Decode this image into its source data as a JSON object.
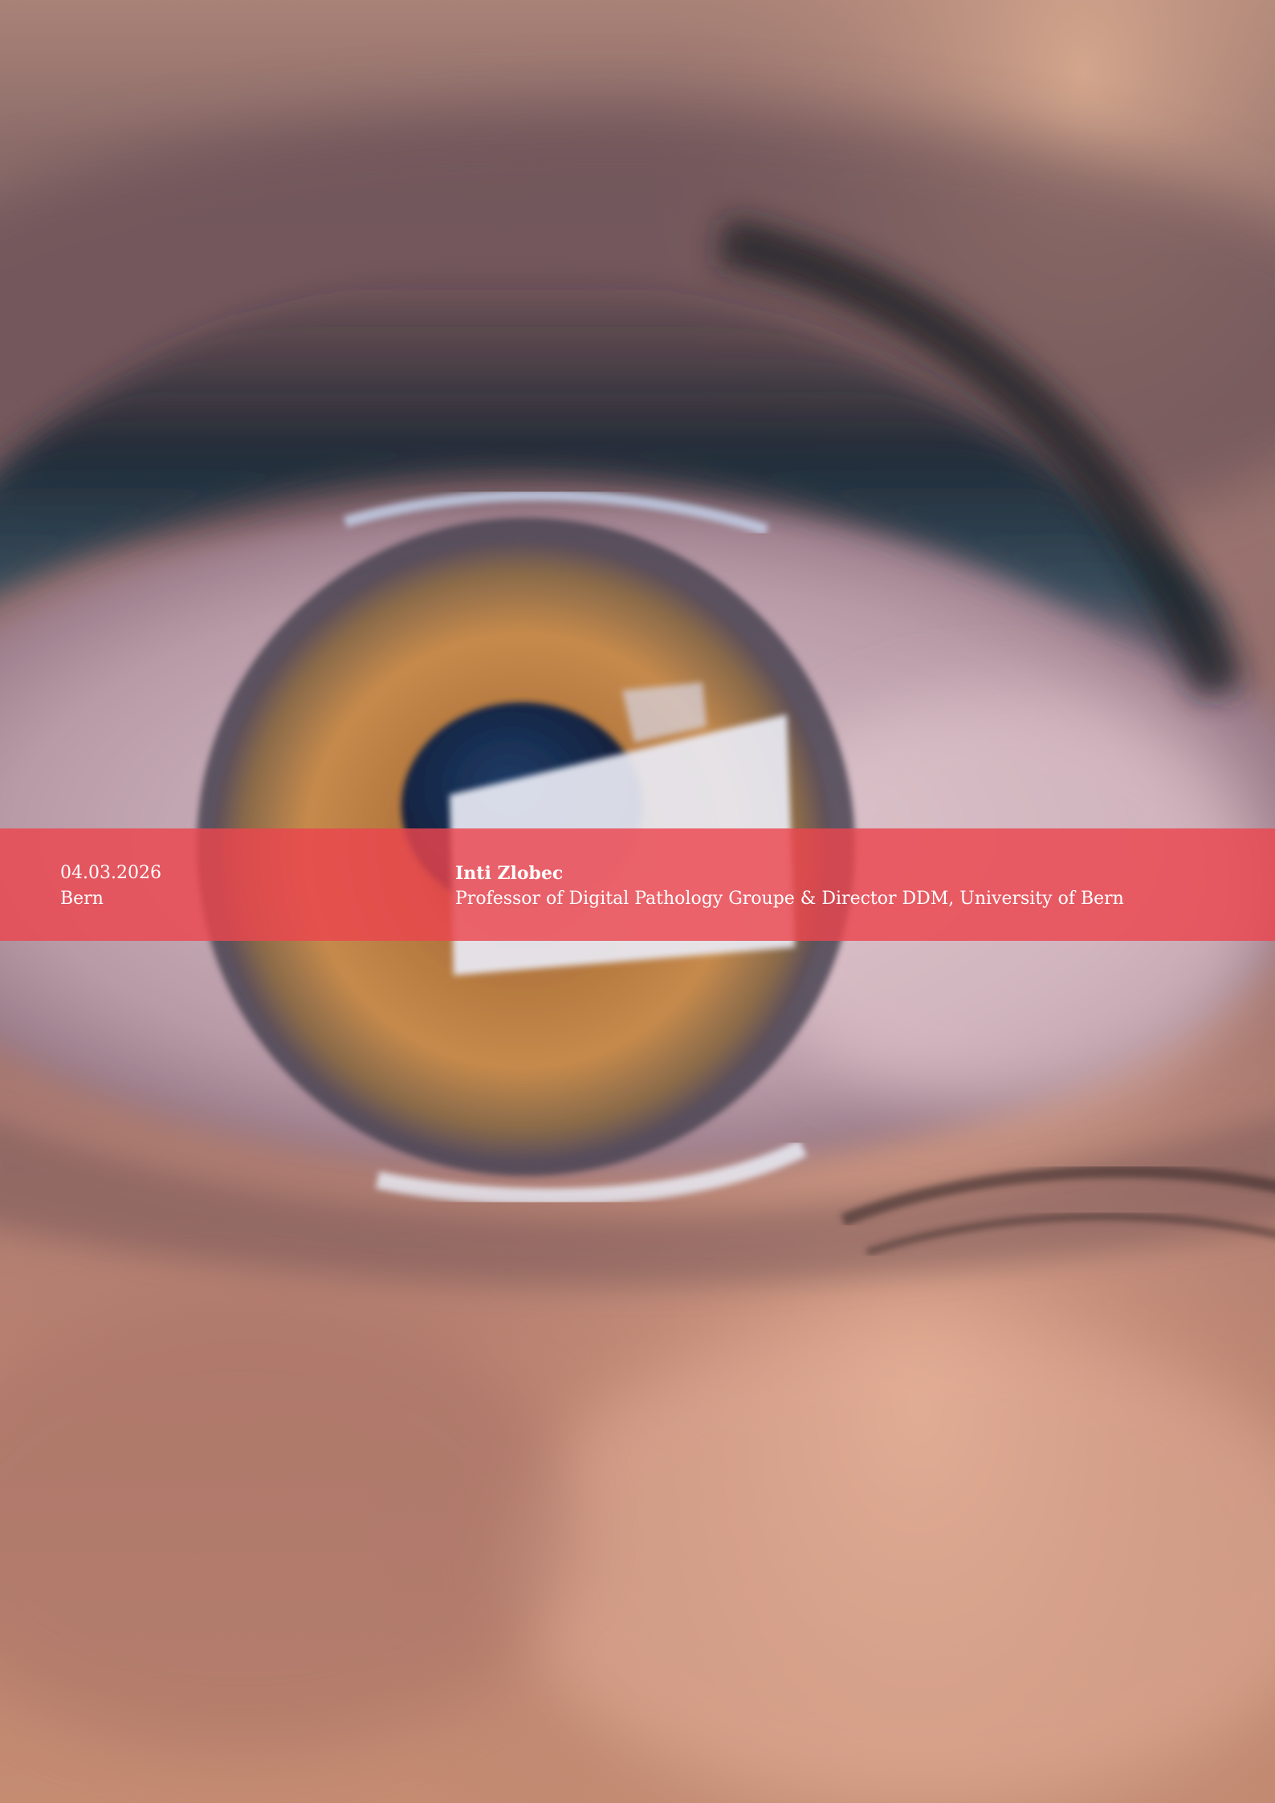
{
  "cover": {
    "date": "04.03.2026",
    "location": "Bern",
    "speaker_name": "Inti Zlobec",
    "speaker_title": "Professor of Digital Pathology Groupe & Director DDM, University of Bern"
  },
  "colors": {
    "band": "#ec464e",
    "text": "#ffffff"
  }
}
